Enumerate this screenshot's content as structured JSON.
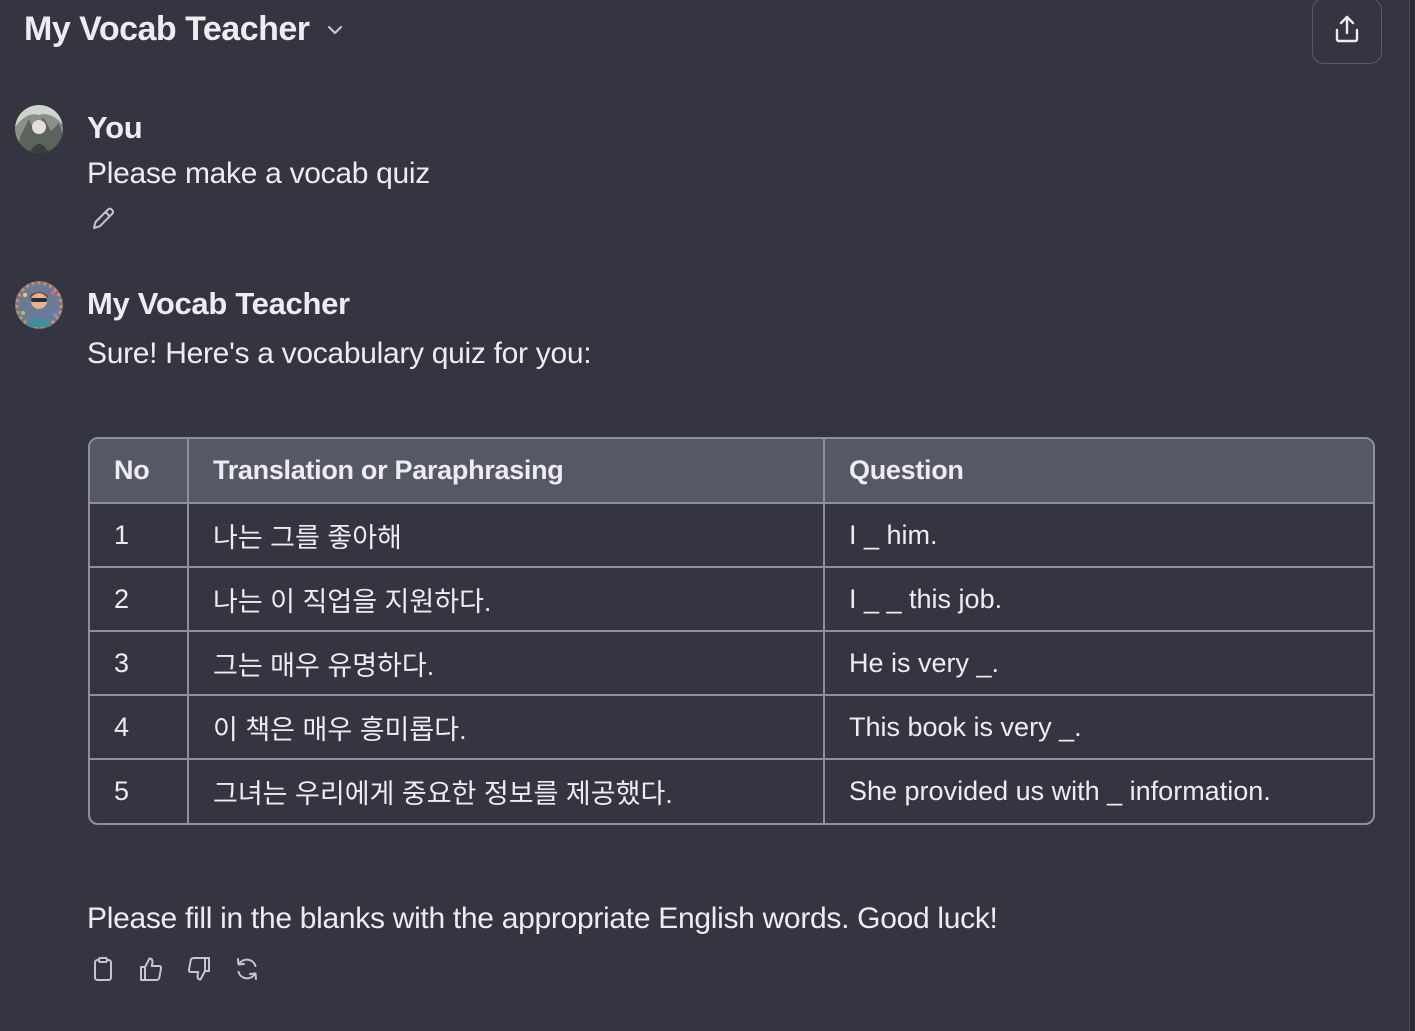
{
  "header": {
    "title": "My Vocab Teacher"
  },
  "messages": [
    {
      "sender": "You",
      "text": "Please make a vocab quiz"
    },
    {
      "sender": "My Vocab Teacher",
      "intro": "Sure! Here's a vocabulary quiz for you:",
      "outro": "Please fill in the blanks with the appropriate English words. Good luck!"
    }
  ],
  "quiz_table": {
    "headers": [
      "No",
      "Translation or Paraphrasing",
      "Question"
    ],
    "rows": [
      [
        "1",
        "나는 그를 좋아해",
        "I _ him."
      ],
      [
        "2",
        "나는 이 직업을 지원하다.",
        "I _ _ this job."
      ],
      [
        "3",
        "그는 매우 유명하다.",
        "He is very _."
      ],
      [
        "4",
        "이 책은 매우 흥미롭다.",
        "This book is very _."
      ],
      [
        "5",
        "그녀는 우리에게 중요한 정보를 제공했다.",
        "She provided us with _ information."
      ]
    ]
  },
  "icons": {
    "header": [
      "chevron-down-icon",
      "share-icon"
    ],
    "user_message": [
      "edit-icon"
    ],
    "assistant_actions": [
      "copy-icon",
      "thumbs-up-icon",
      "thumbs-down-icon",
      "regenerate-icon"
    ]
  },
  "colors": {
    "background": "#343541",
    "text": "#ececf1",
    "table_header": "#565866",
    "table_border": "#8e8ea0",
    "icon": "#c5c5d2"
  }
}
